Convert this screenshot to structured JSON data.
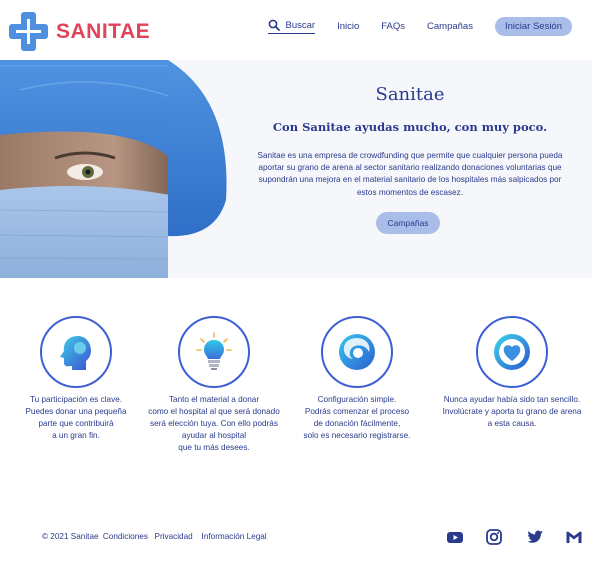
{
  "header": {
    "logo_text": "SANITAE",
    "nav": {
      "search_label": "Buscar",
      "links": [
        "Inicio",
        "FAQs",
        "Campañas"
      ],
      "login_label": "Iniciar Sesión"
    }
  },
  "hero": {
    "title": "Sanitae",
    "subtitle": "Con Sanitae ayudas mucho, con muy poco.",
    "description": "Sanitae es una empresa de crowdfunding que permite que cualquier persona pueda aportar su grano de arena al sector sanitario realizando donaciones voluntarias que supondrán una mejora en el material sanitario de los hospitales más salpicados por estos momentos de escasez.",
    "button_label": "Campañas"
  },
  "features": [
    {
      "icon": "head-icon",
      "text": "Tu participación es clave.\nPuedes donar una pequeña\nparte que contribuirá\na un gran fin."
    },
    {
      "icon": "lightbulb-icon",
      "text": "Tanto el material a donar\ncomo el hospital al que será donado\nserá elección tuya. Con ello podrás\nayudar al hospital\nque tu más desees."
    },
    {
      "icon": "swirl-icon",
      "text": "Configuración simple.\nPodrás comenzar el proceso\nde donación fácilmente,\nsolo es necesario registrarse."
    },
    {
      "icon": "heart-icon",
      "text": "Nunca ayudar había sido tan sencillo.\nInvolúcrate y aporta tu grano de arena\na esta causa."
    }
  ],
  "footer": {
    "copyright": "© 2021 Sanitae",
    "links": [
      "Condiciones",
      "Privacidad",
      "Información Legal"
    ],
    "social": [
      "youtube-icon",
      "instagram-icon",
      "twitter-icon",
      "gmail-icon"
    ]
  },
  "colors": {
    "brand_red": "#e0435a",
    "brand_blue": "#4f8fe0",
    "text_navy": "#2a3a8c",
    "button_bg": "#a9bde8"
  }
}
